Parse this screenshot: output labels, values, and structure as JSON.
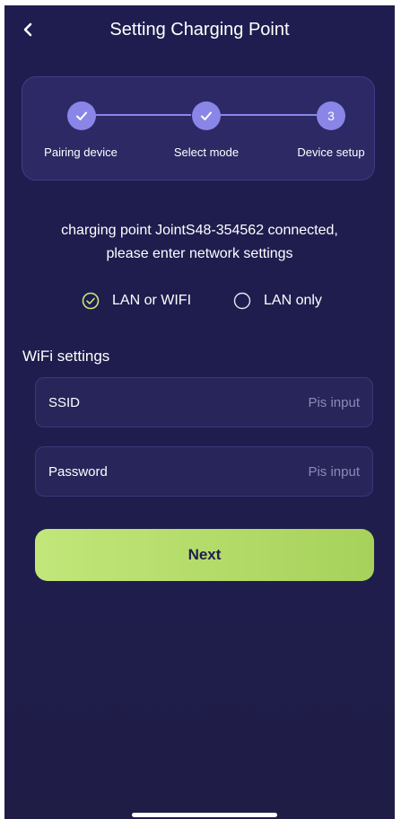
{
  "header": {
    "title": "Setting Charging Point",
    "back_icon": "chevron-left-icon"
  },
  "stepper": {
    "current_step": 3,
    "steps": [
      {
        "label": "Pairing device",
        "state": "done",
        "icon": "check-icon"
      },
      {
        "label": "Select mode",
        "state": "done",
        "icon": "check-icon"
      },
      {
        "label": "Device setup",
        "state": "current",
        "number": "3"
      }
    ]
  },
  "message": {
    "line1": "charging point JointS48-354562 connected,",
    "line2": "please enter network settings"
  },
  "mode": {
    "options": [
      {
        "label": "LAN or WIFI",
        "selected": true
      },
      {
        "label": "LAN only",
        "selected": false
      }
    ]
  },
  "wifi": {
    "section_title": "WiFi settings",
    "ssid": {
      "label": "SSID",
      "placeholder": "Pis input",
      "value": ""
    },
    "password": {
      "label": "Password",
      "placeholder": "Pis input",
      "value": ""
    }
  },
  "actions": {
    "next_label": "Next"
  },
  "colors": {
    "background": "#1f1d4c",
    "accent": "#8a86e8",
    "button": "#b4dc68",
    "selected_radio": "#c8e87a"
  }
}
